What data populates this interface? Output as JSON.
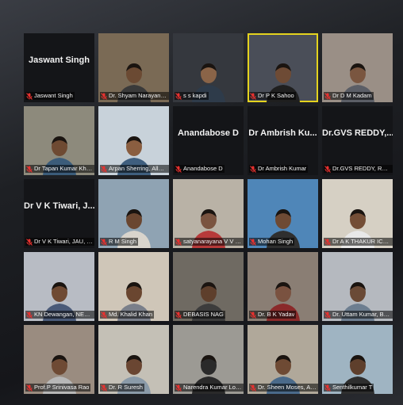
{
  "meeting": {
    "participants": [
      {
        "name": "Jaswant Singh",
        "display": "Jaswant Singh",
        "video": false,
        "active": false,
        "bg": "#141518",
        "skin": "#000000",
        "shirt": "#000000"
      },
      {
        "name": "Dr. Shyam Narayan JHA",
        "display": "",
        "video": true,
        "active": false,
        "bg": "#7a6a55",
        "skin": "#6b4a33",
        "shirt": "#3a3a3a"
      },
      {
        "name": "s s kapdi",
        "display": "",
        "video": true,
        "active": false,
        "bg": "#35383e",
        "skin": "#8a6448",
        "shirt": "#2e3b4a"
      },
      {
        "name": "Dr P K Sahoo",
        "display": "",
        "video": true,
        "active": true,
        "bg": "#4a4e58",
        "skin": "#6e4b35",
        "shirt": "#1f1f1f"
      },
      {
        "name": "Dr D M Kadam",
        "display": "",
        "video": true,
        "active": false,
        "bg": "#9a8f86",
        "skin": "#7a5640",
        "shirt": "#5b5e66"
      },
      {
        "name": "Dr Tapan Kumar Khura",
        "display": "",
        "video": true,
        "active": false,
        "bg": "#8d8a7c",
        "skin": "#6e4a32",
        "shirt": "#3b5c7a"
      },
      {
        "name": "Arpan Sherring, Allahab...",
        "display": "",
        "video": true,
        "active": false,
        "bg": "#c8d2da",
        "skin": "#8a5e40",
        "shirt": "#3f5f7f"
      },
      {
        "name": "Anandabose D",
        "display": "Anandabose D",
        "video": false,
        "active": false,
        "bg": "#141518",
        "skin": "#000000",
        "shirt": "#000000"
      },
      {
        "name": "Dr Ambrish Kumar",
        "display": "Dr Ambrish Ku...",
        "video": false,
        "active": false,
        "bg": "#141518",
        "skin": "#000000",
        "shirt": "#000000"
      },
      {
        "name": "Dr.GVS REDDY, RAICHU...",
        "display": "Dr.GVS REDDY,...",
        "video": false,
        "active": false,
        "bg": "#141518",
        "skin": "#000000",
        "shirt": "#000000"
      },
      {
        "name": "Dr V K Tiwari, JAU, Juna...",
        "display": "Dr V K Tiwari, J...",
        "video": false,
        "active": false,
        "bg": "#141518",
        "skin": "#000000",
        "shirt": "#000000"
      },
      {
        "name": "R M Singh",
        "display": "",
        "video": true,
        "active": false,
        "bg": "#8fa3b3",
        "skin": "#6a4630",
        "shirt": "#d8d4cc"
      },
      {
        "name": "satyanarayana  V V ch, A...",
        "display": "",
        "video": true,
        "active": false,
        "bg": "#b9b2a6",
        "skin": "#7a5440",
        "shirt": "#b73a3a"
      },
      {
        "name": "Mohan Singh",
        "display": "",
        "video": true,
        "active": false,
        "bg": "#4f86b8",
        "skin": "#6e4a34",
        "shirt": "#2f2f2f"
      },
      {
        "name": "Dr A K THAKUR ICAR",
        "display": "",
        "video": true,
        "active": false,
        "bg": "#d6d0c4",
        "skin": "#744e36",
        "shirt": "#e8e8e8"
      },
      {
        "name": "KN Dewangan, NERIST",
        "display": "",
        "video": true,
        "active": false,
        "bg": "#b8bcc4",
        "skin": "#6f4a33",
        "shirt": "#4a5a78"
      },
      {
        "name": "Md. Khalid Khan",
        "display": "",
        "video": true,
        "active": false,
        "bg": "#cfc6b8",
        "skin": "#6a4630",
        "shirt": "#7a7f8a"
      },
      {
        "name": "DEBASIS NAG",
        "display": "",
        "video": true,
        "active": false,
        "bg": "#6f6a62",
        "skin": "#5e3f2c",
        "shirt": "#3c3c3c"
      },
      {
        "name": "Dr. B K Yadav",
        "display": "",
        "video": true,
        "active": false,
        "bg": "#8a7e74",
        "skin": "#7a5240",
        "shirt": "#8a2a2a"
      },
      {
        "name": "Dr. Uttam Kumar, BAU R...",
        "display": "",
        "video": true,
        "active": false,
        "bg": "#b5b9bf",
        "skin": "#6a4a36",
        "shirt": "#6d7e90"
      },
      {
        "name": "Prof.P Srinivasa Rao",
        "display": "",
        "video": true,
        "active": false,
        "bg": "#9a8c80",
        "skin": "#6e4a34",
        "shirt": "#b7b7b7"
      },
      {
        "name": "Dr. R Suresh",
        "display": "",
        "video": true,
        "active": false,
        "bg": "#c4c0b6",
        "skin": "#6a4632",
        "shirt": "#8a9aa8"
      },
      {
        "name": "Narendra Kumar Lohani",
        "display": "",
        "video": true,
        "active": false,
        "bg": "#9c9a94",
        "skin": "#2a2a2a",
        "shirt": "#2a2a2a"
      },
      {
        "name": "Dr. Sheen Moses, Allaha...",
        "display": "",
        "video": true,
        "active": false,
        "bg": "#b0a89a",
        "skin": "#6e4a34",
        "shirt": "#4a6a8a"
      },
      {
        "name": "Senthilkumar T",
        "display": "",
        "video": true,
        "active": false,
        "bg": "#9fb4c2",
        "skin": "#5e3f2c",
        "shirt": "#2e2e2e"
      }
    ]
  }
}
